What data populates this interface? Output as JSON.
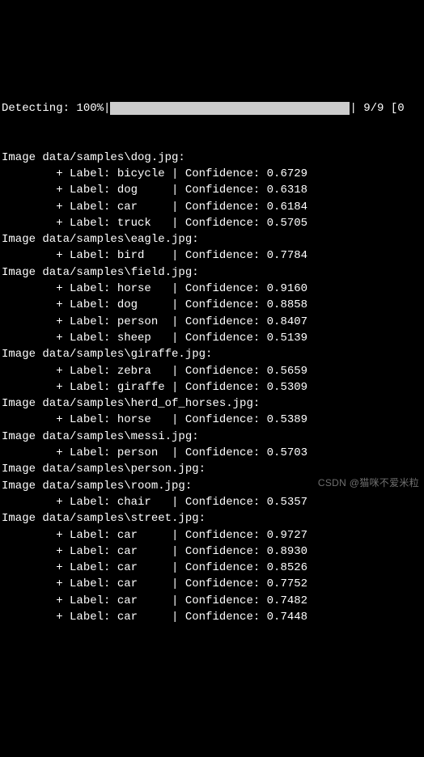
{
  "progress": {
    "label": "Detecting: 100%",
    "counter": " 9/9 [0"
  },
  "images": [
    {
      "header": "Image data/samples\\dog.jpg:",
      "detections": [
        {
          "label": "bicycle",
          "confidence": "0.6729"
        },
        {
          "label": "dog",
          "confidence": "0.6318"
        },
        {
          "label": "car",
          "confidence": "0.6184"
        },
        {
          "label": "truck",
          "confidence": "0.5705"
        }
      ]
    },
    {
      "header": "Image data/samples\\eagle.jpg:",
      "detections": [
        {
          "label": "bird",
          "confidence": "0.7784"
        }
      ]
    },
    {
      "header": "Image data/samples\\field.jpg:",
      "detections": [
        {
          "label": "horse",
          "confidence": "0.9160"
        },
        {
          "label": "dog",
          "confidence": "0.8858"
        },
        {
          "label": "person",
          "confidence": "0.8407"
        },
        {
          "label": "sheep",
          "confidence": "0.5139"
        }
      ]
    },
    {
      "header": "Image data/samples\\giraffe.jpg:",
      "detections": [
        {
          "label": "zebra",
          "confidence": "0.5659"
        },
        {
          "label": "giraffe",
          "confidence": "0.5309"
        }
      ]
    },
    {
      "header": "Image data/samples\\herd_of_horses.jpg:",
      "detections": [
        {
          "label": "horse",
          "confidence": "0.5389"
        }
      ]
    },
    {
      "header": "Image data/samples\\messi.jpg:",
      "detections": [
        {
          "label": "person",
          "confidence": "0.5703"
        }
      ]
    },
    {
      "header": "Image data/samples\\person.jpg:",
      "detections": []
    },
    {
      "header": "Image data/samples\\room.jpg:",
      "detections": [
        {
          "label": "chair",
          "confidence": "0.5357"
        }
      ]
    },
    {
      "header": "Image data/samples\\street.jpg:",
      "detections": [
        {
          "label": "car",
          "confidence": "0.9727"
        },
        {
          "label": "car",
          "confidence": "0.8930"
        },
        {
          "label": "car",
          "confidence": "0.8526"
        },
        {
          "label": "car",
          "confidence": "0.7752"
        },
        {
          "label": "car",
          "confidence": "0.7482"
        },
        {
          "label": "car",
          "confidence": "0.7448"
        }
      ]
    }
  ],
  "watermark": "CSDN @猫咪不爱米粒"
}
